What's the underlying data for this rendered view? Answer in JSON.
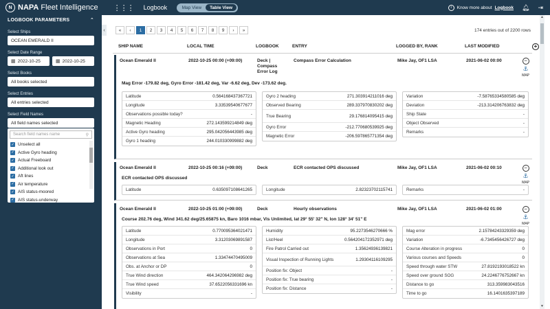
{
  "topbar": {
    "logo_mark": "N",
    "brand": "NAPA",
    "product": "Fleet Intelligence",
    "grid_icon": "apps-grid-icon",
    "page": "Logbook",
    "views": [
      "Map View",
      "Table View"
    ],
    "active_view": "Table View",
    "know_more_prefix": "Know more about",
    "know_more_link": "Logbook",
    "icons": [
      "info-icon",
      "bell-icon",
      "logout-icon"
    ]
  },
  "sidebar": {
    "header": "LOGBOOK PARAMETERS",
    "ships_label": "Select Ships",
    "ships_value": "OCEAN EMERALD II",
    "date_label": "Select Date Range",
    "date_from": "2022-10-25",
    "date_to": "2022-10-25",
    "books_label": "Select Books",
    "books_value": "All books selected",
    "entries_label": "Select Entries",
    "entries_value": "All entries selected",
    "fields_label": "Select Field Names",
    "fields_value": "All field names selected",
    "search_placeholder": "Search field names name",
    "options": [
      "Unselect all",
      "Active Gyro heading",
      "Actual Freeboard",
      "Additional look out",
      "Aft lines",
      "Air temperature",
      "AIS status-moored",
      "AIS status-underway"
    ]
  },
  "pager": {
    "pages": [
      "«",
      "‹",
      "1",
      "2",
      "3",
      "4",
      "5",
      "6",
      "7",
      "8",
      "9",
      "›",
      "»"
    ],
    "current": "1",
    "count_text": "174 entries out of 2200 rows"
  },
  "table": {
    "headers": {
      "ship": "SHIP NAME",
      "time": "LOCAL TIME",
      "logbook": "LOGBOOK",
      "entry": "ENTRY",
      "logged_by": "LOGGED BY, RANK",
      "modified": "LAST MODIFIED"
    },
    "entries": [
      {
        "ship": "Ocean Emerald II",
        "time": "2022-10-25 00:00 (+09:00)",
        "logbook": "Deck | Compass Error Log",
        "entry": "Compass Error Calculation",
        "logged_by": "Mike Jay, OF1 LSA",
        "modified": "2021-06-02 00:00",
        "summary": "Mag Error -179.82 deg, Gyro Error -181.42 deg, Var -6.62 deg, Dev -173.62 deg.",
        "map_label": "MAP",
        "col1": [
          [
            "Latitude",
            "0.564168437367721"
          ],
          [
            "Longitude",
            "3.33539540677677"
          ],
          [
            "Observations possible today?",
            "-"
          ],
          [
            "Magnetic Heading",
            "272.143599214849 deg"
          ],
          [
            "Active Gyro heading",
            "295.042056443985 deg"
          ],
          [
            "Gyro 1 heading",
            "244.010330999882 deg"
          ]
        ],
        "col2": [
          [
            "Gyro 2 heading",
            "271.303914211016 deg"
          ],
          [
            "Observed Bearing",
            "289.337970830202 deg"
          ],
          [
            "True Bearing",
            "29.176814095415 deg"
          ],
          [
            "Gyro Error",
            "-212.770680539925 deg"
          ],
          [
            "Magnetic Error",
            "-206.597865771354 deg"
          ]
        ],
        "col3": [
          [
            "Variation",
            "-7.58765334580585 deg"
          ],
          [
            "Deviation",
            "-213.314206763832 deg"
          ],
          [
            "Ship State",
            "-"
          ],
          [
            "Object Observed",
            "-"
          ],
          [
            "Remarks",
            "-"
          ]
        ]
      },
      {
        "ship": "Ocean Emerald II",
        "time": "2022-10-25 00:16 (+09:00)",
        "logbook": "Deck",
        "entry": "ECR contacted OPS discussed",
        "logged_by": "Mike Jay, OF1 LSA",
        "modified": "2021-06-02 00:10",
        "summary": "ECR contacted OPS discussed",
        "map_label": "MAP",
        "col1": [
          [
            "Latitude",
            "0.635097108641265"
          ]
        ],
        "col2": [
          [
            "Longitude",
            "2.82323702115741"
          ]
        ],
        "col3": [
          [
            "Remarks",
            "-"
          ]
        ]
      },
      {
        "ship": "Ocean Emerald II",
        "time": "2022-10-25 01:00 (+09:00)",
        "logbook": "Deck",
        "entry": "Hourly observations",
        "logged_by": "Mike Jay, OF1 LSA",
        "modified": "2021-06-02 01:00",
        "summary": "Course 202.76 deg, Wind 341.62 deg/25.65875 kn, Baro 1016 mbar, Vis Unlimited, lat 29° 55' 32\" N, lon 128° 34' 51\" E",
        "map_label": "MAP",
        "col1": [
          [
            "Latitude",
            "0.770095364021471"
          ],
          [
            "Longitude",
            "3.31203069891587"
          ],
          [
            "Observations in Port",
            "0"
          ],
          [
            "Observations at Sea",
            "1.33474470495009"
          ],
          [
            "Obs. at Anchor or DP",
            "0"
          ],
          [
            "True Wind direction",
            "464.342064296982 deg"
          ],
          [
            "True Wind speed",
            "37.6522056331696 kn"
          ],
          [
            "Visibility",
            "-"
          ]
        ],
        "col2": [
          [
            "Humidity",
            "95.2273546270666 %"
          ],
          [
            "List/Heel",
            "0.564204172352971 deg"
          ],
          [
            "Fire Patrol Carried out",
            "1.35624936139821"
          ],
          [
            "Visual Inspection of Running Lights",
            "1.29304116109295"
          ],
          [
            "Position fix: Object",
            "-"
          ],
          [
            "Position fix: True bearing",
            "-"
          ],
          [
            "Position fix: Distance",
            "-"
          ]
        ],
        "col3": [
          [
            "Mag error",
            "2.15784243329359 deg"
          ],
          [
            "Variation",
            "-6.7345456426727 deg"
          ],
          [
            "Course Alteration in progress",
            "0"
          ],
          [
            "Various courses and Speeds",
            "0"
          ],
          [
            "Speed through water STW",
            "27.8192193018522 kn"
          ],
          [
            "Speed over ground SOG",
            "24.2246776752667 kn"
          ],
          [
            "Distance to go",
            "313.359983043516"
          ],
          [
            "Time to go",
            "16.1401635397189"
          ]
        ]
      }
    ]
  }
}
